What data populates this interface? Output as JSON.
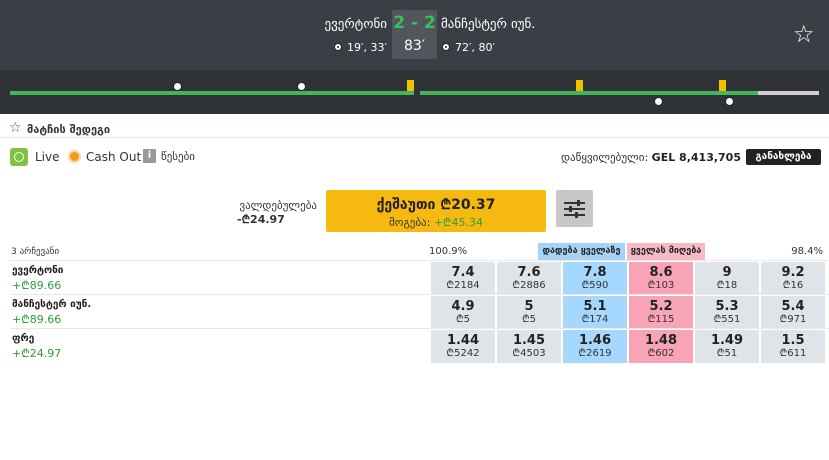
{
  "header": {
    "home_team": "ევერტონი",
    "away_team": "მანჩესტერ იუნ.",
    "score": "2 - 2",
    "minute": "83′",
    "home_goals": "19′, 33′",
    "away_goals": "72′, 80′"
  },
  "match_info": {
    "label": "მატჩის შედეგი"
  },
  "status": {
    "live": "Live",
    "cashout": "Cash Out",
    "info_glyph": "i",
    "rules": "წესები",
    "matched_label": "დაწყვილებული:",
    "matched_value": "GEL 8,413,705",
    "calculate": "განახლება"
  },
  "betslip": {
    "liability_label": "ვალდებულება",
    "liability_value": "-₾24.97",
    "place_label": "ქეშაუთი ₾20.37",
    "profit_label": "მოგება:",
    "profit_value": "+₾45.34"
  },
  "market": {
    "selections": "3 არჩევანი",
    "back_pct": "100.9%",
    "lay_pct": "98.4%",
    "back_all": "დადება ყველაზე",
    "lay_all": "ყველას მიღება"
  },
  "runners": [
    {
      "name": "ევერტონი",
      "pl": "+₾89.66",
      "prices": [
        {
          "odd": "7.4",
          "stake": "₾2184"
        },
        {
          "odd": "7.6",
          "stake": "₾2886"
        },
        {
          "odd": "7.8",
          "stake": "₾590"
        },
        {
          "odd": "8.6",
          "stake": "₾103"
        },
        {
          "odd": "9",
          "stake": "₾18"
        },
        {
          "odd": "9.2",
          "stake": "₾16"
        }
      ]
    },
    {
      "name": "მანჩესტერ იუნ.",
      "pl": "+₾89.66",
      "prices": [
        {
          "odd": "4.9",
          "stake": "₾5"
        },
        {
          "odd": "5",
          "stake": "₾5"
        },
        {
          "odd": "5.1",
          "stake": "₾174"
        },
        {
          "odd": "5.2",
          "stake": "₾115"
        },
        {
          "odd": "5.3",
          "stake": "₾551"
        },
        {
          "odd": "5.4",
          "stake": "₾971"
        }
      ]
    },
    {
      "name": "ფრე",
      "pl": "+₾24.97",
      "prices": [
        {
          "odd": "1.44",
          "stake": "₾5242"
        },
        {
          "odd": "1.45",
          "stake": "₾4503"
        },
        {
          "odd": "1.46",
          "stake": "₾2619"
        },
        {
          "odd": "1.48",
          "stake": "₾602"
        },
        {
          "odd": "1.49",
          "stake": "₾51"
        },
        {
          "odd": "1.5",
          "stake": "₾611"
        }
      ]
    }
  ],
  "colors": {
    "back": "#a6d8ff",
    "lay": "#f9a3b6",
    "score": "#39c057",
    "action": "#f5b90f"
  },
  "icons": [
    "football-icon",
    "star-icon",
    "stopwatch-icon",
    "cashout-icon",
    "info-icon",
    "sliders-icon",
    "yellow-card-icon"
  ]
}
